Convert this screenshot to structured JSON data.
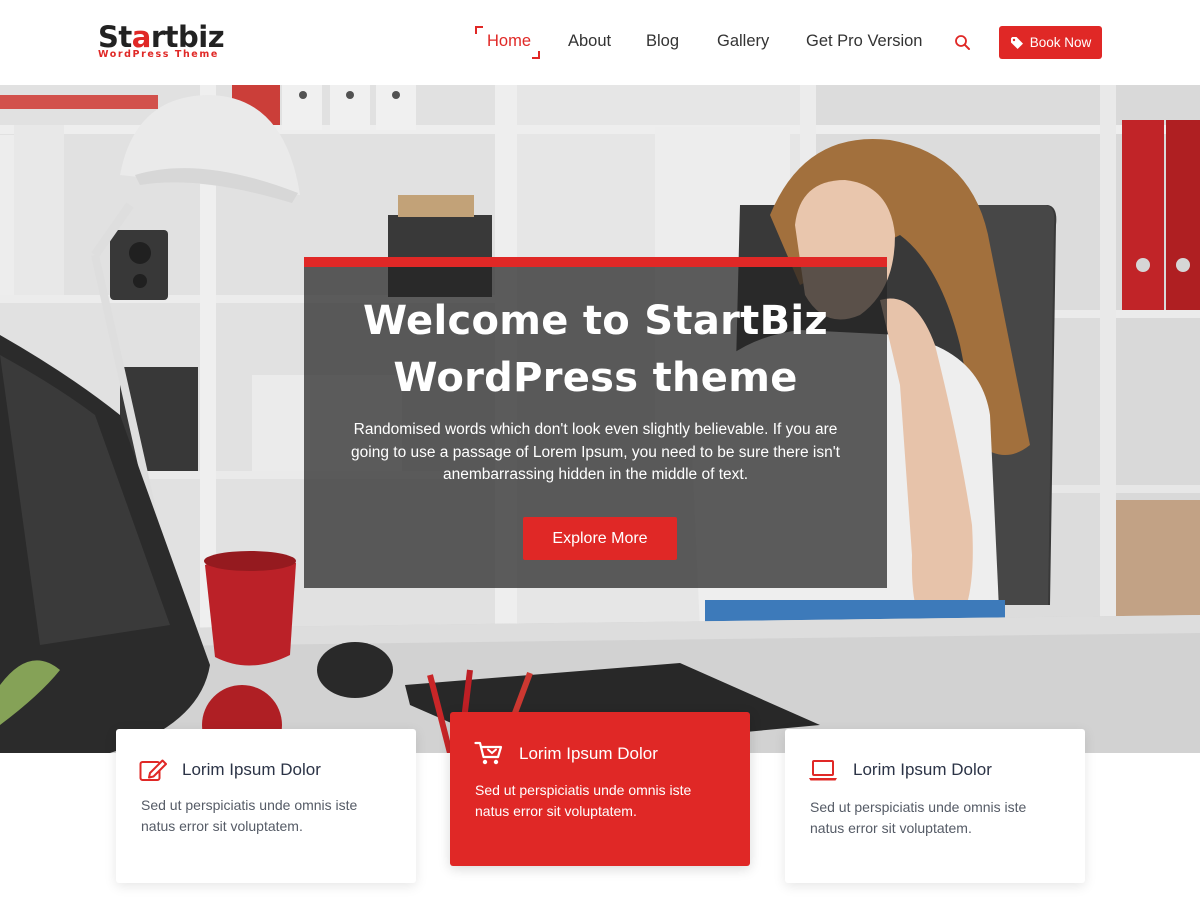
{
  "brand": {
    "logo_part1": "St",
    "logo_accent": "a",
    "logo_part2": "rtbiz",
    "tagline": "WordPress Theme",
    "accent_color": "#e02826"
  },
  "nav": {
    "items": [
      {
        "label": "Home",
        "active": true
      },
      {
        "label": "About"
      },
      {
        "label": "Blog"
      },
      {
        "label": "Gallery"
      },
      {
        "label": "Get Pro Version"
      }
    ],
    "search_icon": "search-icon",
    "book_button": {
      "label": "Book Now",
      "icon": "tag-icon"
    }
  },
  "hero": {
    "title_line1": "Welcome to StartBiz",
    "title_line2": "WordPress theme",
    "description": "Randomised words which don't look even slightly believable. If you are going to use a passage of Lorem Ipsum, you need to be sure there isn't anembarrassing hidden in the middle of text.",
    "cta_label": "Explore More"
  },
  "features": [
    {
      "icon": "edit-icon",
      "title": "Lorim Ipsum Dolor",
      "text": "Sed ut perspiciatis unde omnis iste natus error sit voluptatem.",
      "highlighted": false
    },
    {
      "icon": "cart-icon",
      "title": "Lorim Ipsum Dolor",
      "text": "Sed ut perspiciatis unde omnis iste natus error sit voluptatem.",
      "highlighted": true
    },
    {
      "icon": "laptop-icon",
      "title": "Lorim Ipsum Dolor",
      "text": "Sed ut perspiciatis unde omnis iste natus error sit voluptatem.",
      "highlighted": false
    }
  ]
}
